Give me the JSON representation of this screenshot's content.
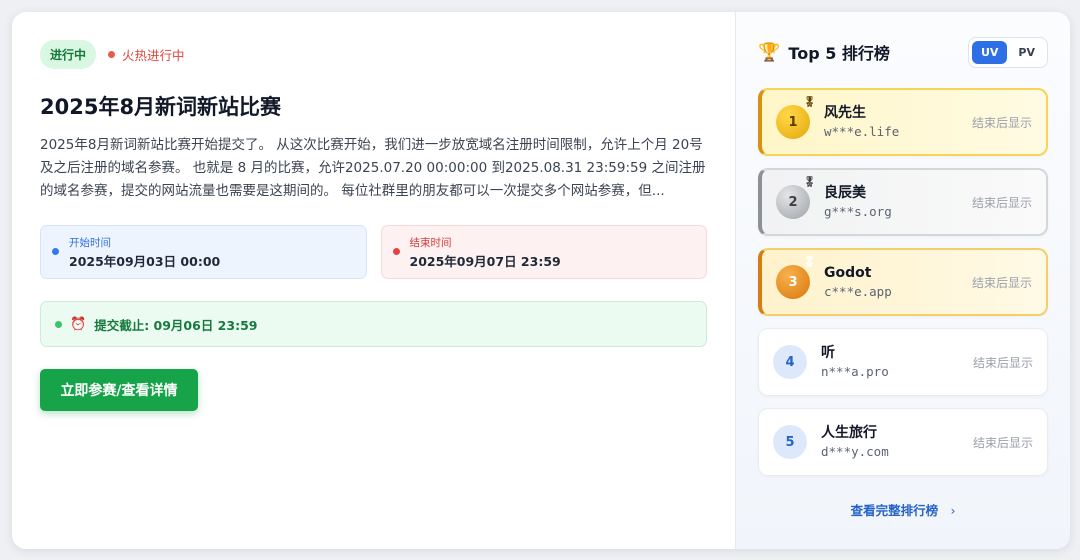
{
  "contest": {
    "status_badge": "进行中",
    "hot_label": "火热进行中",
    "title": "2025年8月新词新站比赛",
    "description": "2025年8月新词新站比赛开始提交了。 从这次比赛开始，我们进一步放宽域名注册时间限制，允许上个月 20号及之后注册的域名参赛。 也就是 8 月的比赛，允许2025.07.20 00:00:00 到2025.08.31 23:59:59 之间注册的域名参赛，提交的网站流量也需要是这期间的。 每位社群里的朋友都可以一次提交多个网站参赛，但...",
    "start_label": "开始时间",
    "start_value": "2025年09月03日 00:00",
    "end_label": "结束时间",
    "end_value": "2025年09月07日 23:59",
    "deadline_icon": "⏰",
    "deadline_text": "提交截止: 09月06日 23:59",
    "cta_label": "立即参赛/查看详情"
  },
  "ranking": {
    "title": "Top 5 排行榜",
    "trophy_icon": "🏆",
    "toggle": [
      "UV",
      "PV"
    ],
    "active_toggle": "UV",
    "items": [
      {
        "rank": "1",
        "name": "风先生",
        "domain": "w***e.life",
        "status": "结束后显示"
      },
      {
        "rank": "2",
        "name": "良辰美",
        "domain": "g***s.org",
        "status": "结束后显示"
      },
      {
        "rank": "3",
        "name": "Godot",
        "domain": "c***e.app",
        "status": "结束后显示"
      },
      {
        "rank": "4",
        "name": "听",
        "domain": "n***a.pro",
        "status": "结束后显示"
      },
      {
        "rank": "5",
        "name": "人生旅行",
        "domain": "d***y.com",
        "status": "结束后显示"
      }
    ],
    "view_all": "查看完整排行榜",
    "view_all_icon": "›"
  },
  "colors": {
    "accent_green": "#16a34a",
    "accent_blue": "#2f6fe6",
    "hot_red": "#e0453a"
  }
}
